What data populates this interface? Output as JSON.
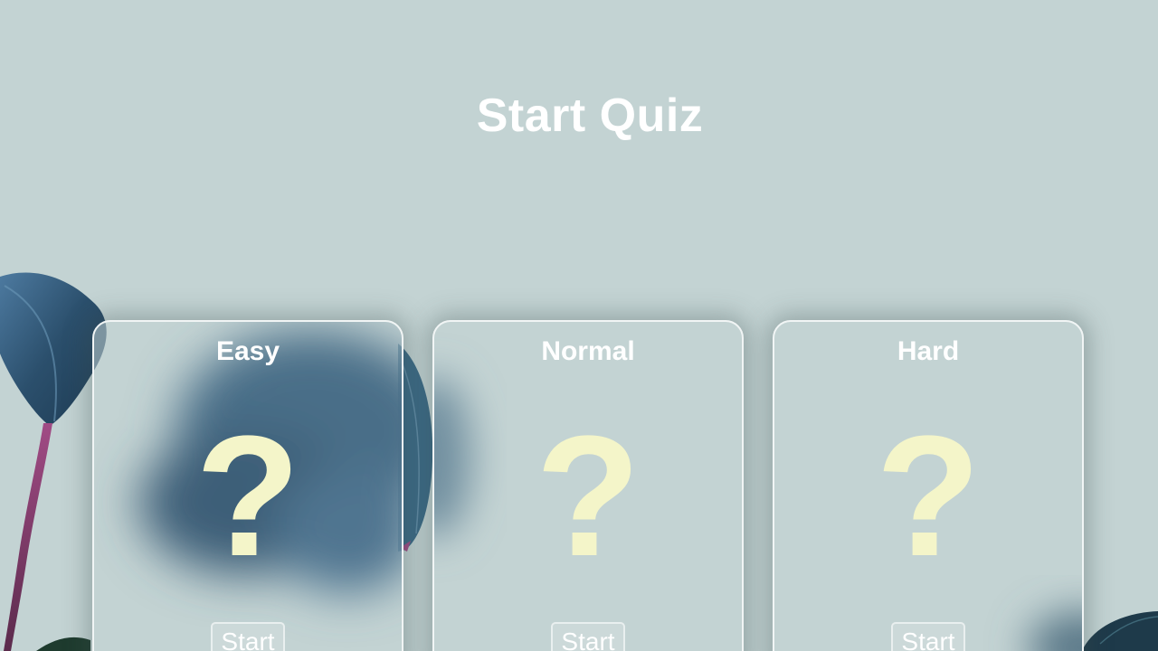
{
  "page": {
    "title": "Start Quiz"
  },
  "cards": [
    {
      "label": "Easy",
      "icon": "question-mark-icon",
      "icon_glyph": "?",
      "button_label": "Start"
    },
    {
      "label": "Normal",
      "icon": "question-mark-icon",
      "icon_glyph": "?",
      "button_label": "Start"
    },
    {
      "label": "Hard",
      "icon": "question-mark-icon",
      "icon_glyph": "?",
      "button_label": "Start"
    }
  ],
  "colors": {
    "background": "#c3d3d3",
    "title_text": "#ffffff",
    "question_mark": "#f4f5c9",
    "card_border": "#f1f5f5",
    "leaf_dark": "#2f5670"
  }
}
